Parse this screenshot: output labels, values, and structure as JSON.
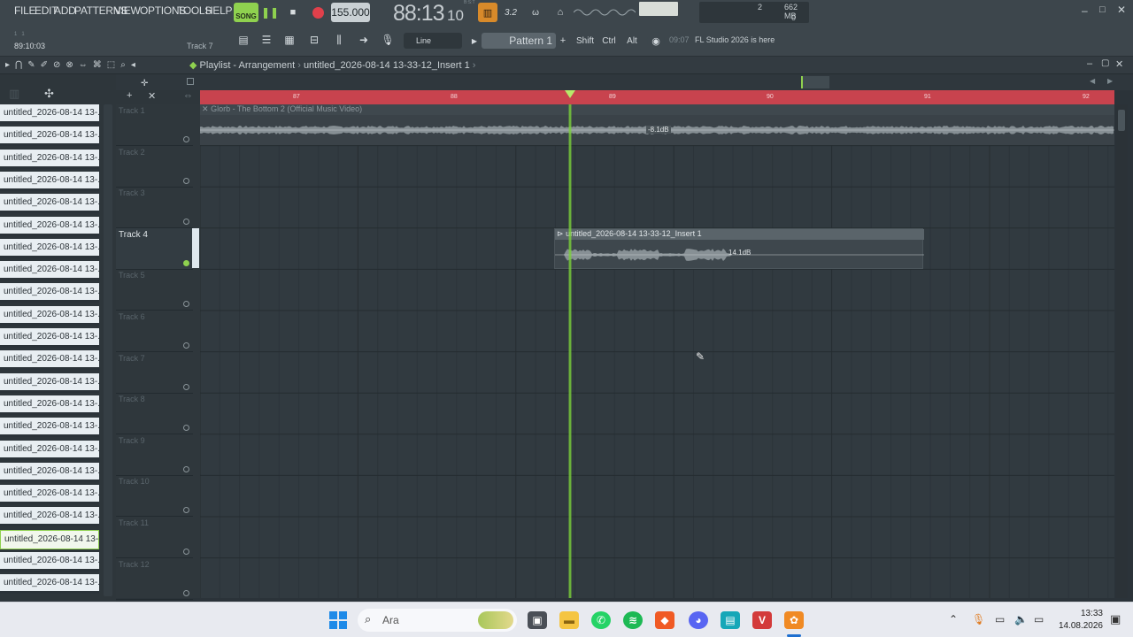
{
  "menu": [
    "FILE",
    "EDIT",
    "ADD",
    "PATTERNS",
    "VIEW",
    "OPTIONS",
    "TOOLS",
    "HELP"
  ],
  "transport": {
    "song_label": "SONG",
    "tempo": "155.000",
    "time_main": "88:13",
    "time_sub": "10",
    "time_top": "B:S:T"
  },
  "hint": {
    "position": "89:10:03",
    "track": "Track 7"
  },
  "toolbar": {
    "snap_label": "Line",
    "pattern_label": "Pattern 1",
    "shift": "Shift",
    "ctrl": "Ctrl",
    "alt": "Alt"
  },
  "news": {
    "time": "09:07",
    "text": "FL Studio 2026 is here"
  },
  "meters": {
    "voices": "2",
    "memory": "662 MB",
    "cpu": "0"
  },
  "playlist": {
    "title": "Playlist - Arrangement",
    "breadcrumb_sep": "›",
    "clip_name": "untitled_2026-08-14 13-33-12_Insert 1"
  },
  "ruler": [
    "87",
    "88",
    "89",
    "90",
    "91",
    "92"
  ],
  "browser_items": [
    "untitled_2026-08-14 13-...",
    "untitled_2026-08-14 13-...",
    "untitled_2026-08-14 13-...",
    "untitled_2026-08-14 13-...",
    "untitled_2026-08-14 13-...",
    "untitled_2026-08-14 13-...",
    "untitled_2026-08-14 13-...",
    "untitled_2026-08-14 13-...",
    "untitled_2026-08-14 13-...",
    "untitled_2026-08-14 13-...",
    "untitled_2026-08-14 13-...",
    "untitled_2026-08-14 13-...",
    "untitled_2026-08-14 13-...",
    "untitled_2026-08-14 13-...",
    "untitled_2026-08-14 13-...",
    "untitled_2026-08-14 13-...",
    "untitled_2026-08-14 13-...",
    "untitled_2026-08-14 13-...",
    "untitled_2026-08-14 13-...",
    "untitled_2026-08-14 13-...",
    "untitled_2026-08-14 13-...",
    "untitled_2026-08-14 13-..."
  ],
  "selected_browser_index": 19,
  "tracks": [
    "Track 1",
    "Track 2",
    "Track 3",
    "Track 4",
    "Track 5",
    "Track 6",
    "Track 7",
    "Track 8",
    "Track 9",
    "Track 10",
    "Track 11",
    "Track 12"
  ],
  "active_track_index": 3,
  "clips": {
    "track1_label": "Glorb - The Bottom 2 (Official Music Video)",
    "track1_gain": "-8.1dB",
    "track4_label": "untitled_2026-08-14 13-33-12_Insert 1",
    "track4_gain": "14.1dB"
  },
  "taskbar": {
    "search_label": "Ara",
    "clock": "13:33",
    "date": "14.08.2026"
  },
  "colors": {
    "accent_green": "#8fd14f",
    "playhead": "#7bd13a",
    "ruler": "#c8434e"
  }
}
